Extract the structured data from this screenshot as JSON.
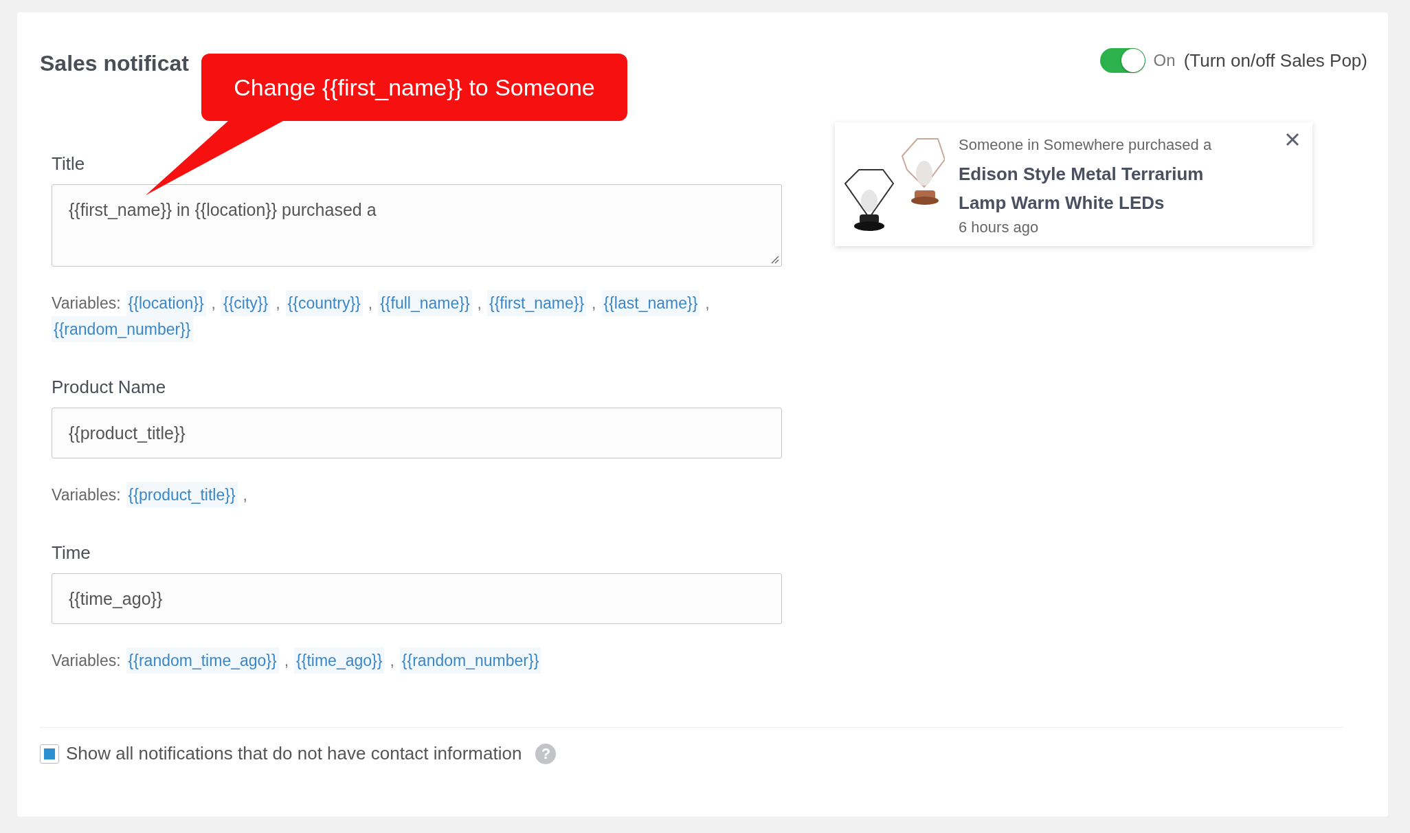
{
  "heading": "Sales notificat",
  "callout": {
    "text": "Change {{first_name}} to Someone"
  },
  "toggle": {
    "on": true,
    "state_label": "On",
    "description": "(Turn on/off Sales Pop)"
  },
  "fields": [
    {
      "label": "Title",
      "kind": "textarea",
      "value": "{{first_name}} in {{location}} purchased a",
      "variables_label": "Variables:",
      "variables": [
        {
          "kind": "variable",
          "text": "{{location}}"
        },
        {
          "kind": "separator",
          "text": ","
        },
        {
          "kind": "variable",
          "text": "{{city}}"
        },
        {
          "kind": "separator",
          "text": ","
        },
        {
          "kind": "variable",
          "text": "{{country}}"
        },
        {
          "kind": "separator",
          "text": ","
        },
        {
          "kind": "variable",
          "text": "{{full_name}}"
        },
        {
          "kind": "separator",
          "text": ","
        },
        {
          "kind": "variable",
          "text": "{{first_name}}"
        },
        {
          "kind": "separator",
          "text": ","
        },
        {
          "kind": "variable",
          "text": "{{last_name}}"
        },
        {
          "kind": "separator",
          "text": ","
        },
        {
          "kind": "variable",
          "text": "{{random_number}}"
        }
      ]
    },
    {
      "label": "Product Name",
      "kind": "input",
      "value": "{{product_title}}",
      "variables_label": "Variables:",
      "variables": [
        {
          "kind": "variable",
          "text": "{{product_title}}"
        },
        {
          "kind": "separator",
          "text": ","
        }
      ]
    },
    {
      "label": "Time",
      "kind": "input",
      "value": "{{time_ago}}",
      "variables_label": "Variables:",
      "variables": [
        {
          "kind": "variable",
          "text": "{{random_time_ago}}"
        },
        {
          "kind": "separator",
          "text": ","
        },
        {
          "kind": "variable",
          "text": "{{time_ago}}"
        },
        {
          "kind": "separator",
          "text": ","
        },
        {
          "kind": "variable",
          "text": "{{random_number}}"
        }
      ]
    }
  ],
  "preview": {
    "line": "Someone in Somewhere purchased a",
    "product": "Edison Style Metal Terrarium Lamp Warm White LEDs",
    "time": "6 hours ago"
  },
  "option": {
    "checked": true,
    "label": "Show all notifications that do not have contact information",
    "help": "?"
  }
}
